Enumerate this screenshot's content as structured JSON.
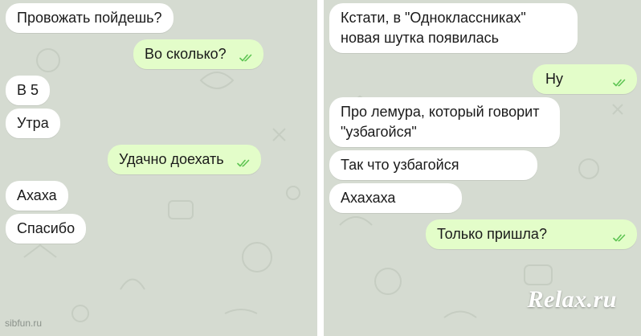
{
  "left_chat": {
    "messages": [
      {
        "text": "Провожать пойдешь?",
        "direction": "in"
      },
      {
        "text": "Во сколько?",
        "direction": "out",
        "status": "read"
      },
      {
        "text": "В 5",
        "direction": "in"
      },
      {
        "text": "Утра",
        "direction": "in"
      },
      {
        "text": "Удачно доехать",
        "direction": "out",
        "status": "read"
      },
      {
        "text": "Ахаха",
        "direction": "in"
      },
      {
        "text": "Спасибо",
        "direction": "in"
      }
    ]
  },
  "right_chat": {
    "messages": [
      {
        "lines": [
          "Кстати, в \"Одноклассниках\"",
          "новая шутка появилась"
        ],
        "direction": "in"
      },
      {
        "text": "Ну",
        "direction": "out",
        "status": "read"
      },
      {
        "lines": [
          "Про лемура, который говорит",
          "\"узбагойся\""
        ],
        "direction": "in"
      },
      {
        "text": "Так что узбагойся",
        "direction": "in"
      },
      {
        "text": "Ахахаха",
        "direction": "in"
      },
      {
        "text": "Только пришла?",
        "direction": "out",
        "status": "read"
      }
    ]
  },
  "watermark": "Relax.ru",
  "credit": "sibfun.ru",
  "colors": {
    "chat_background": "#d5dbd1",
    "incoming_bubble": "#ffffff",
    "outgoing_bubble": "#e3fdc9",
    "read_check": "#5dc452"
  },
  "icons": [
    "double-check-icon"
  ]
}
